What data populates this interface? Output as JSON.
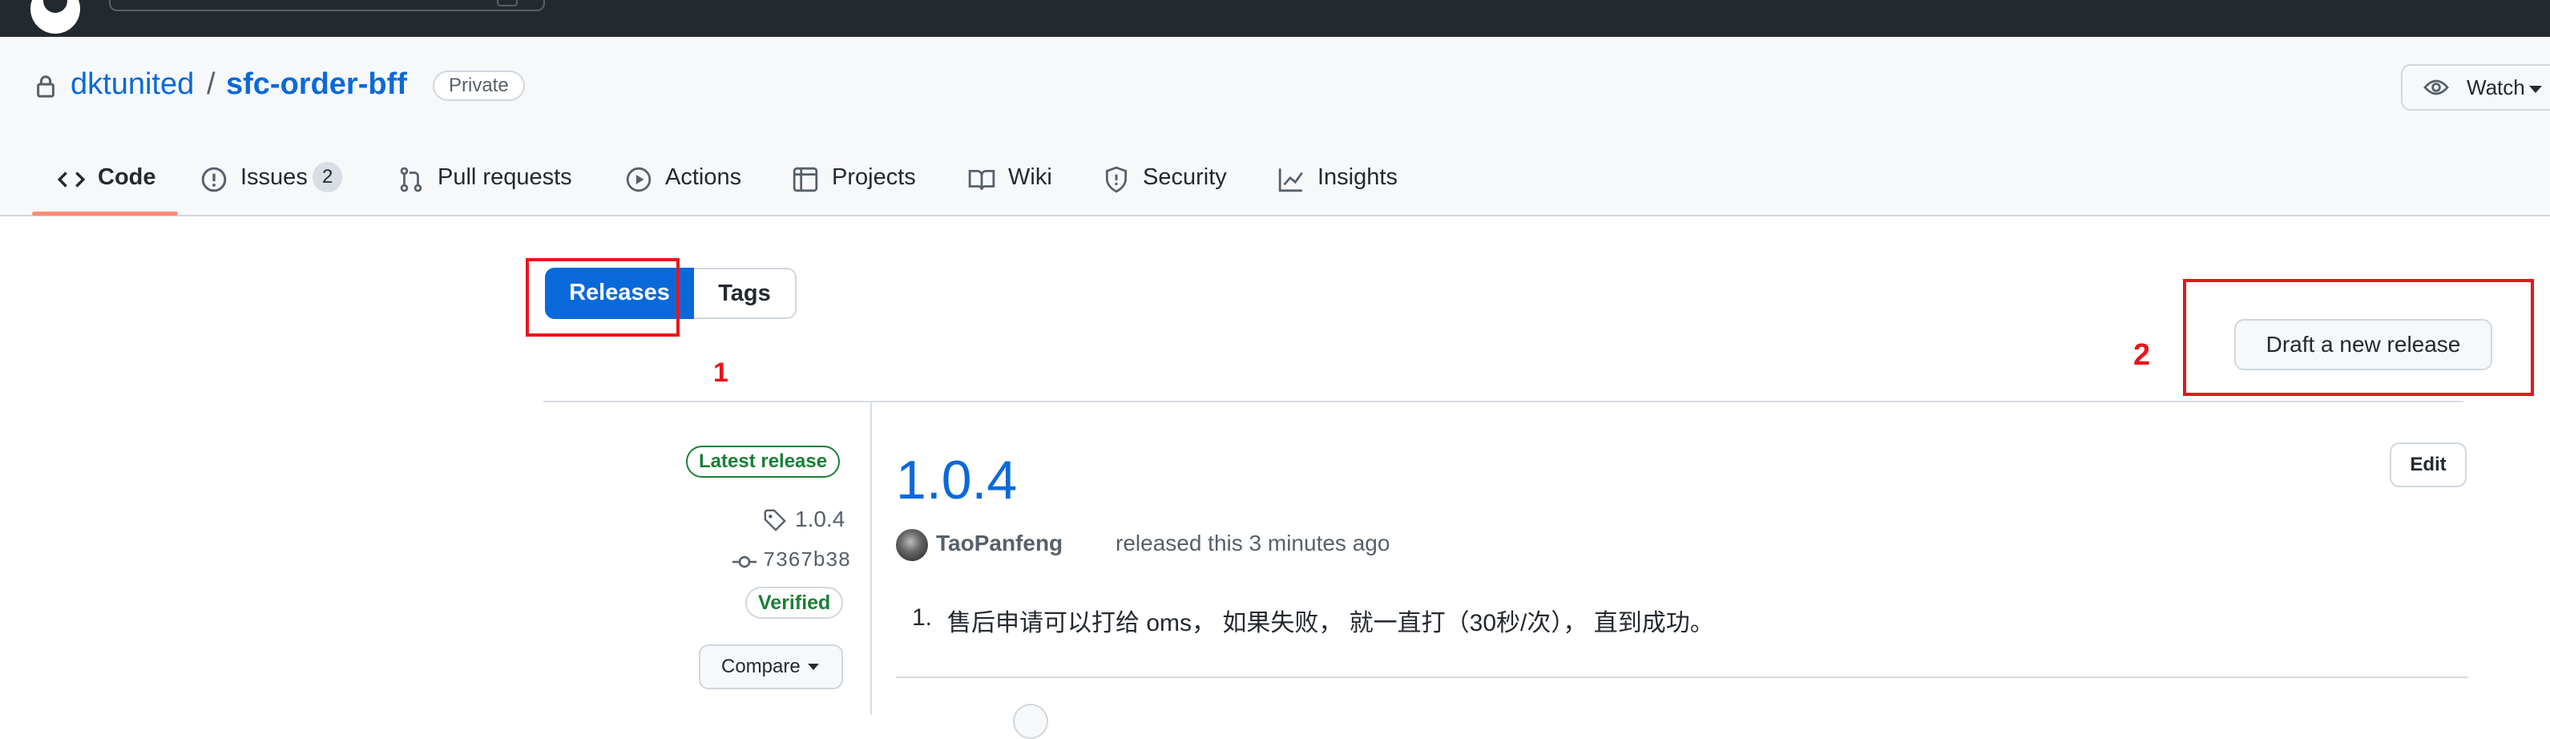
{
  "repo": {
    "owner": "dktunited",
    "slash": "/",
    "name": "sfc-order-bff",
    "visibility": "Private",
    "watch_label": "Watch"
  },
  "tabs": [
    {
      "label": "Code",
      "icon": "code-icon"
    },
    {
      "label": "Issues",
      "icon": "issue-icon",
      "count": "2"
    },
    {
      "label": "Pull requests",
      "icon": "pull-request-icon"
    },
    {
      "label": "Actions",
      "icon": "play-icon"
    },
    {
      "label": "Projects",
      "icon": "table-icon"
    },
    {
      "label": "Wiki",
      "icon": "book-icon"
    },
    {
      "label": "Security",
      "icon": "shield-icon"
    },
    {
      "label": "Insights",
      "icon": "graph-icon"
    }
  ],
  "subnav": {
    "releases": "Releases",
    "tags": "Tags",
    "draft_button": "Draft a new release"
  },
  "annotations": {
    "one": "1",
    "two": "2"
  },
  "release": {
    "badge": "Latest release",
    "tag": "1.0.4",
    "commit": "7367b38",
    "verified": "Verified",
    "compare": "Compare",
    "title": "1.0.4",
    "edit": "Edit",
    "author": "TaoPanfeng",
    "released_text": "released this 3 minutes ago",
    "notes": [
      {
        "num": "1.",
        "text": "售后申请可以打给 oms， 如果失败， 就一直打（30秒/次）， 直到成功。"
      }
    ]
  },
  "colors": {
    "accent": "#0969da",
    "annotation": "#e8161a",
    "success": "#1a7f37",
    "header": "#24292f"
  }
}
